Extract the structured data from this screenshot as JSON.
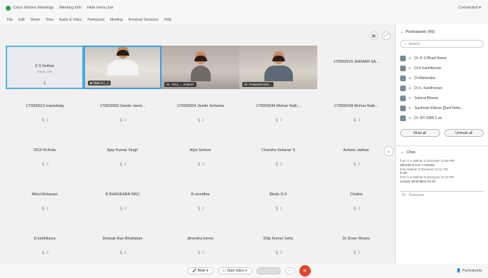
{
  "window": {
    "title_items": [
      "Cisco Webex Meetings",
      "Meeting Info",
      "Hide menu bar"
    ],
    "right_label": "Connected ▾"
  },
  "menu": [
    "File",
    "Edit",
    "Share",
    "View",
    "Audio & Video",
    "Participant",
    "Meeting",
    "Breakout Sessions",
    "Help"
  ],
  "grid": {
    "rows": [
      [
        {
          "type": "self",
          "name": "S S Sekhar",
          "sub": "(Host, me)",
          "mic": "🎙"
        },
        {
          "type": "video",
          "variant": "v1",
          "chip": "■ Tilak D (...)"
        },
        {
          "type": "video",
          "variant": "v2",
          "chip": "Dr. TALL.....SHEST"
        },
        {
          "type": "video",
          "variant": "v3",
          "chip": "Dr. Prasanth Kirti..."
        },
        {
          "type": "name",
          "name": "1705009V9 JEEMAR SA...",
          "mic": ""
        }
      ],
      [
        {
          "type": "name",
          "name": "170000913 manisbelg",
          "mic": "🎙 2"
        },
        {
          "type": "name",
          "name": "170500002 Dande Jaent...",
          "mic": "🎙 2"
        },
        {
          "type": "name",
          "name": "170050004 Jivethi Sehwela",
          "mic": "🎙 2"
        },
        {
          "type": "name",
          "name": "170050049 Mohan Nath...",
          "mic": "🎙 2"
        },
        {
          "type": "name",
          "name": "170500049 Mohan Nath...",
          "mic": "🎙 2"
        }
      ],
      [
        {
          "type": "name",
          "name": "2519 M Anila",
          "mic": "🎙 2"
        },
        {
          "type": "name",
          "name": "Ajay Kumar Singh",
          "mic": "🎙 2"
        },
        {
          "type": "name",
          "name": "Atya Sohere",
          "mic": "🎙 2"
        },
        {
          "type": "name",
          "name": "Chandra Sekaran S",
          "mic": "🎙 2"
        },
        {
          "type": "name",
          "name": "Ashwin Jadhav",
          "mic": "🎙 2"
        }
      ],
      [
        {
          "type": "name",
          "name": "Athul Mohanan",
          "mic": "🎙 2"
        },
        {
          "type": "name",
          "name": "B BHASKARA RAO",
          "mic": "🎙 2"
        },
        {
          "type": "name",
          "name": "B sreedhar",
          "mic": "🎙 2"
        },
        {
          "type": "name",
          "name": "Bindu G K",
          "mic": "🎙 2"
        },
        {
          "type": "name",
          "name": "Chaitra",
          "mic": "🎙 2"
        }
      ],
      [
        {
          "type": "name",
          "name": "D.karthikeya",
          "mic": "🎙 2"
        },
        {
          "type": "name",
          "name": "Deepak Rao Bhattaban",
          "mic": "🎙 2"
        },
        {
          "type": "name",
          "name": "dinendra kenny",
          "mic": "🎙 2"
        },
        {
          "type": "name",
          "name": "Dilip Kumar Sahu",
          "mic": "🎙 2"
        },
        {
          "type": "name",
          "name": "Dr Dixee Moses",
          "mic": "🎙 2"
        }
      ]
    ]
  },
  "participants": {
    "header": "Participants (66)",
    "search_placeholder": "Search",
    "items": [
      {
        "name": "Dr. K S Bhadi Rama"
      },
      {
        "name": "Dr.K Karthikeyan"
      },
      {
        "name": "Dr.Mahendra"
      },
      {
        "name": "Dr.S. Kandhivnan"
      },
      {
        "name": "Samrat Biswas"
      },
      {
        "name": "Santhosh Kittena (Bum'Hehe..."
      },
      {
        "name": "Dr. MT 0989 2 an"
      }
    ],
    "mute_all": "Mute all",
    "unmute_all": "Unmute all"
  },
  "chat": {
    "header": "Chat",
    "lines": [
      "from S S Sekhar to Everyone   12:09 PM",
      "will start in 5 to 7 minutes",
      "from Sekhar to Everyone   12:11 PM",
      "hi all",
      "from S S Sekhar to Everyone   12:11 PM",
      "Lecture Information for all"
    ],
    "to_label": "To:",
    "to_value": "Everyone"
  },
  "bottom": {
    "mute_label": "🎤 Mute ▾",
    "start_video_label": "▭ Start video ▾",
    "more_label": "···",
    "end_label": "✕",
    "participants_label": "👤 Participants"
  },
  "colors": {
    "accent": "#3aa0e0",
    "end_call": "#e0452f"
  }
}
